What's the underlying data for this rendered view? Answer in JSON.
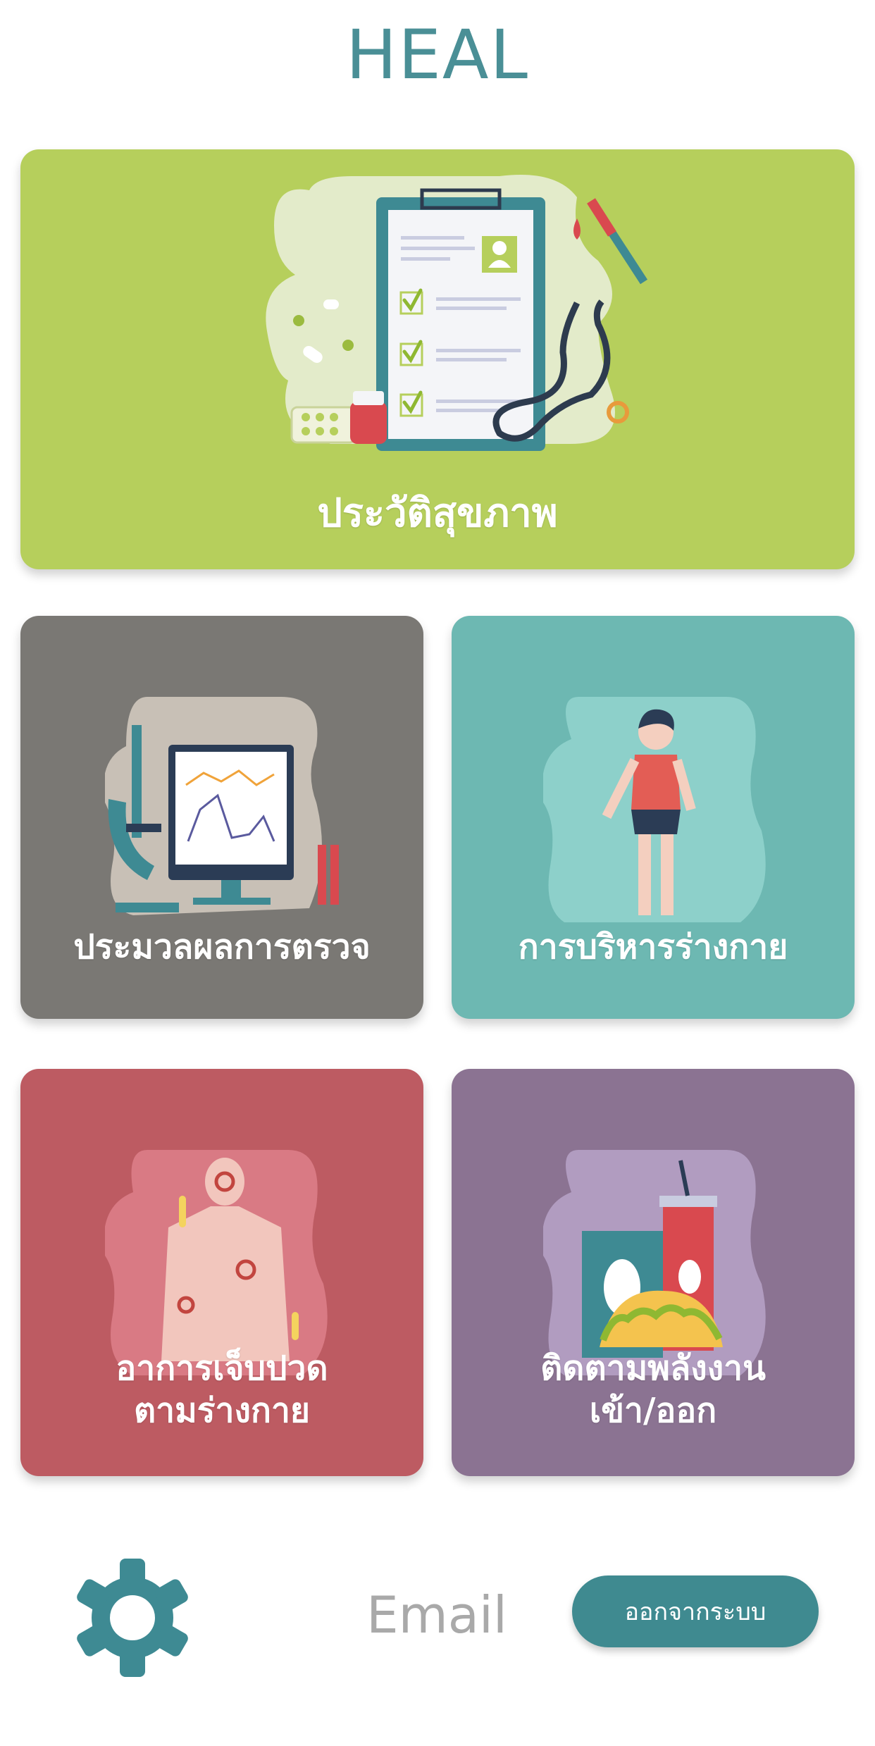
{
  "app": {
    "title": "HEAL"
  },
  "cards": {
    "health_history": {
      "label": "ประวัติสุขภาพ",
      "icon": "medical-clipboard-illustration",
      "color": "#b6cf5c"
    },
    "test_results": {
      "label": "ประมวลผลการตรวจ",
      "icon": "microscope-monitor-illustration",
      "color": "#7a7874"
    },
    "exercise": {
      "label": "การบริหารร่างกาย",
      "icon": "exercising-person-illustration",
      "color": "#6db8b2"
    },
    "pain_symptoms": {
      "label_line1": "อาการเจ็บปวด",
      "label_line2": "ตามร่างกาย",
      "icon": "body-pain-illustration",
      "color": "#bd5b62"
    },
    "energy_tracking": {
      "label_line1": "ติดตามพลังงาน",
      "label_line2": "เข้า/ออก",
      "icon": "food-drink-illustration",
      "color": "#8b7392"
    }
  },
  "footer": {
    "settings_icon": "gear-icon",
    "email_label": "Email",
    "logout_label": "ออกจากระบบ",
    "accent_color": "#3f8a90"
  }
}
